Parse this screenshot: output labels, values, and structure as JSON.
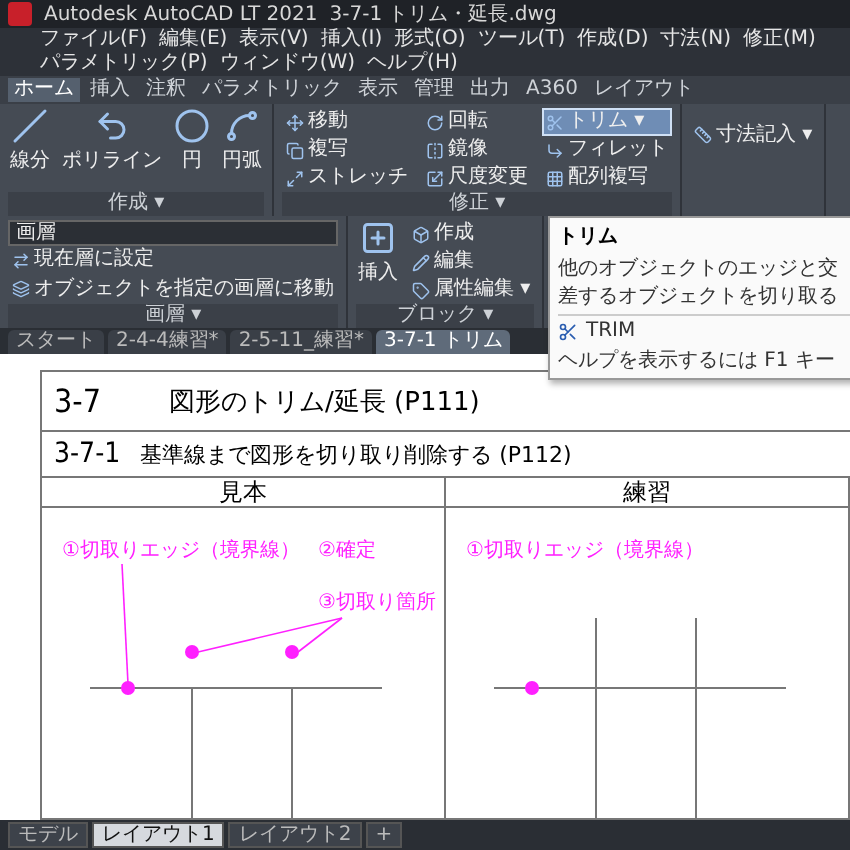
{
  "title_bar": {
    "app": "Autodesk AutoCAD LT 2021",
    "file": "3-7-1 トリム・延長.dwg"
  },
  "menu": [
    "ファイル(F)",
    "編集(E)",
    "表示(V)",
    "挿入(I)",
    "形式(O)",
    "ツール(T)",
    "作成(D)",
    "寸法(N)",
    "修正(M)",
    "パラメトリック(P)",
    "ウィンドウ(W)",
    "ヘルプ(H)"
  ],
  "ribbon_tabs": [
    {
      "label": "ホーム",
      "selected": true
    },
    {
      "label": "挿入",
      "selected": false
    },
    {
      "label": "注釈",
      "selected": false
    },
    {
      "label": "パラメトリック",
      "selected": false
    },
    {
      "label": "表示",
      "selected": false
    },
    {
      "label": "管理",
      "selected": false
    },
    {
      "label": "出力",
      "selected": false
    },
    {
      "label": "A360",
      "selected": false
    },
    {
      "label": "レイアウト",
      "selected": false
    }
  ],
  "ribbon_panels": [
    {
      "title": "作成 ▾",
      "tools": [
        {
          "label": "線分",
          "kind": "large",
          "active": false
        },
        {
          "label": "ポリライン",
          "kind": "large",
          "active": false
        },
        {
          "label": "円",
          "kind": "large",
          "active": false
        },
        {
          "label": "円弧",
          "kind": "large",
          "active": false
        }
      ]
    },
    {
      "title": "修正 ▾",
      "tools": [
        {
          "label": "移動",
          "kind": "small",
          "active": false
        },
        {
          "label": "複写",
          "kind": "small",
          "active": false
        },
        {
          "label": "ストレッチ",
          "kind": "small",
          "active": false
        },
        {
          "label": "回転",
          "kind": "small",
          "active": false
        },
        {
          "label": "鏡像",
          "kind": "small",
          "active": false
        },
        {
          "label": "尺度変更",
          "kind": "small",
          "active": false
        },
        {
          "label": "トリム ▾",
          "kind": "small",
          "active": true
        },
        {
          "label": "フィレット",
          "kind": "small",
          "active": false
        },
        {
          "label": "配列複写",
          "kind": "small",
          "active": false
        }
      ]
    },
    {
      "tools": [
        {
          "label": "寸法記入 ▾",
          "kind": "small",
          "active": false
        }
      ]
    },
    {
      "title": "画層 ▾",
      "tools": [
        {
          "label": "画層",
          "kind": "dropdown",
          "active": false
        },
        {
          "label": "現在層に設定",
          "kind": "small",
          "active": false
        },
        {
          "label": "オブジェクトを指定の画層に移動",
          "kind": "small",
          "active": false
        }
      ]
    },
    {
      "title": "ブロック ▾",
      "tools": [
        {
          "label": "挿入",
          "kind": "large",
          "active": false
        },
        {
          "label": "作成",
          "kind": "small",
          "active": false
        },
        {
          "label": "編集",
          "kind": "small",
          "active": false
        },
        {
          "label": "属性編集 ▾",
          "kind": "small",
          "active": false
        }
      ]
    }
  ],
  "file_tabs": [
    {
      "label": "スタート",
      "selected": false
    },
    {
      "label": "2-4-4練習*",
      "selected": false
    },
    {
      "label": "2-5-11_練習*",
      "selected": false
    },
    {
      "label": "3-7-1 トリム",
      "selected": true
    }
  ],
  "tooltip": {
    "title": "トリム",
    "description": "他のオブジェクトのエッジと交差するオブジェクトを切り取る",
    "command": "TRIM",
    "help": "ヘルプを表示するには F1 キー"
  },
  "drawing": {
    "section_number": "3-7",
    "section_title": "図形のトリム/延長 (P111)",
    "subsection_number": "3-7-1",
    "subsection_title": "基準線まで図形を切り取り削除する (P112)",
    "panels": [
      {
        "heading": "見本",
        "kind": "sample",
        "labels": [
          "①切取りエッジ（境界線）",
          "②確定",
          "③切取り箇所"
        ]
      },
      {
        "heading": "練習",
        "kind": "practice",
        "labels": [
          "①切取りエッジ（境界線）"
        ]
      }
    ]
  },
  "layout_tabs": [
    {
      "label": "モデル",
      "selected": false
    },
    {
      "label": "レイアウト1",
      "selected": true
    },
    {
      "label": "レイアウト2",
      "selected": false
    },
    {
      "label": "+",
      "selected": false
    }
  ]
}
